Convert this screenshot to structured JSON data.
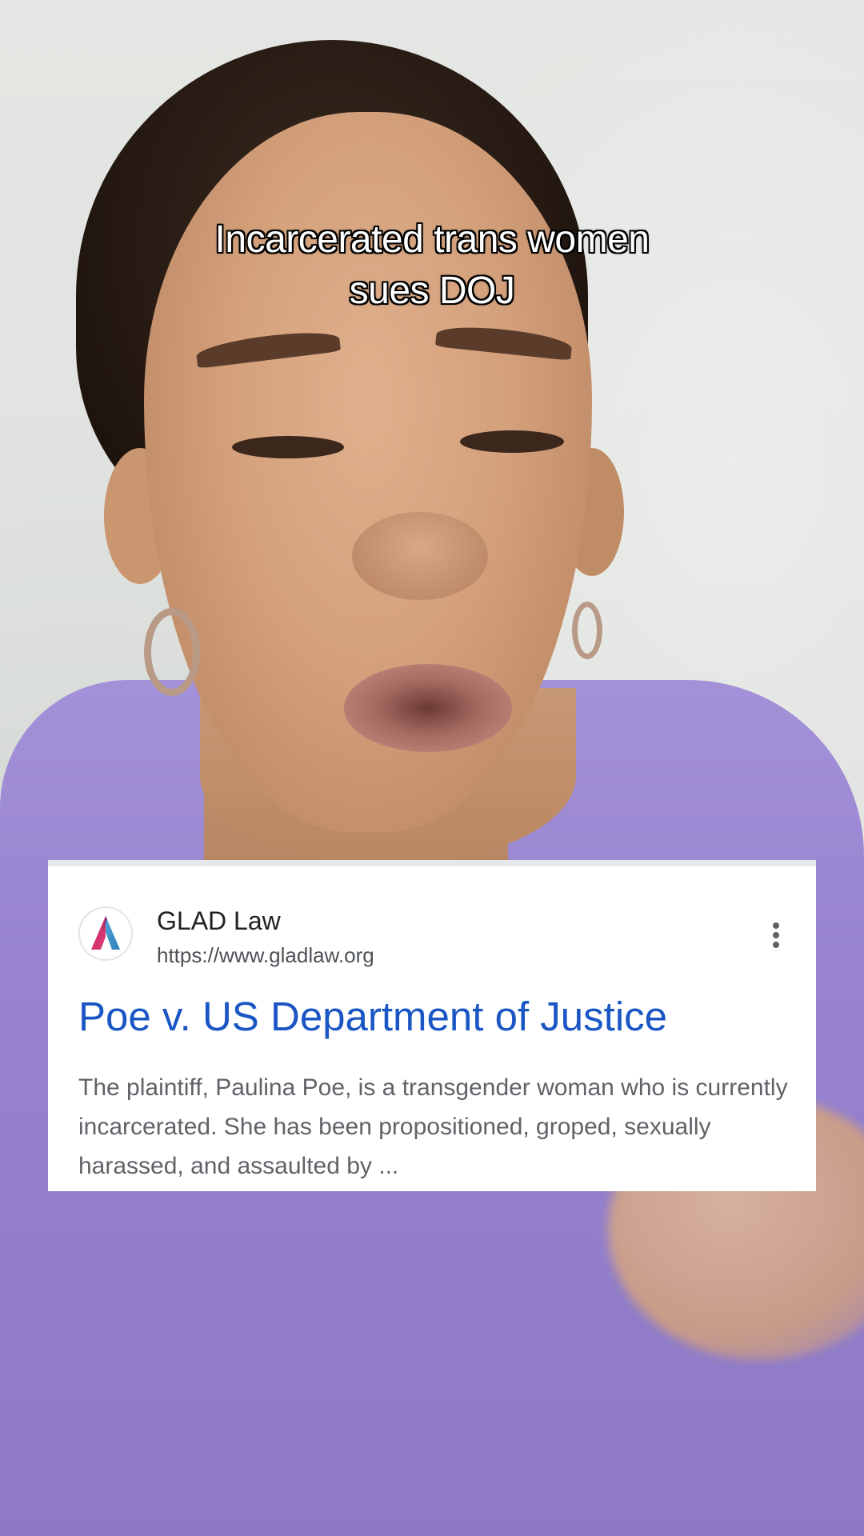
{
  "caption": {
    "line1": "Incarcerated trans women",
    "line2": "sues DOJ"
  },
  "search_result": {
    "site_name": "GLAD Law",
    "site_url": "https://www.gladlaw.org",
    "title": "Poe v. US Department of Justice",
    "snippet": "The plaintiff, Paulina Poe, is a transgender woman who is currently incarcerated. She has been propositioned, groped, sexually harassed, and assaulted by ...",
    "logo_icon": "glad-law-logo-icon",
    "menu_icon": "more-vert-icon"
  },
  "colors": {
    "title_link": "#1a56c4",
    "shirt": "#9783cf",
    "card_bg": "#ffffff"
  }
}
